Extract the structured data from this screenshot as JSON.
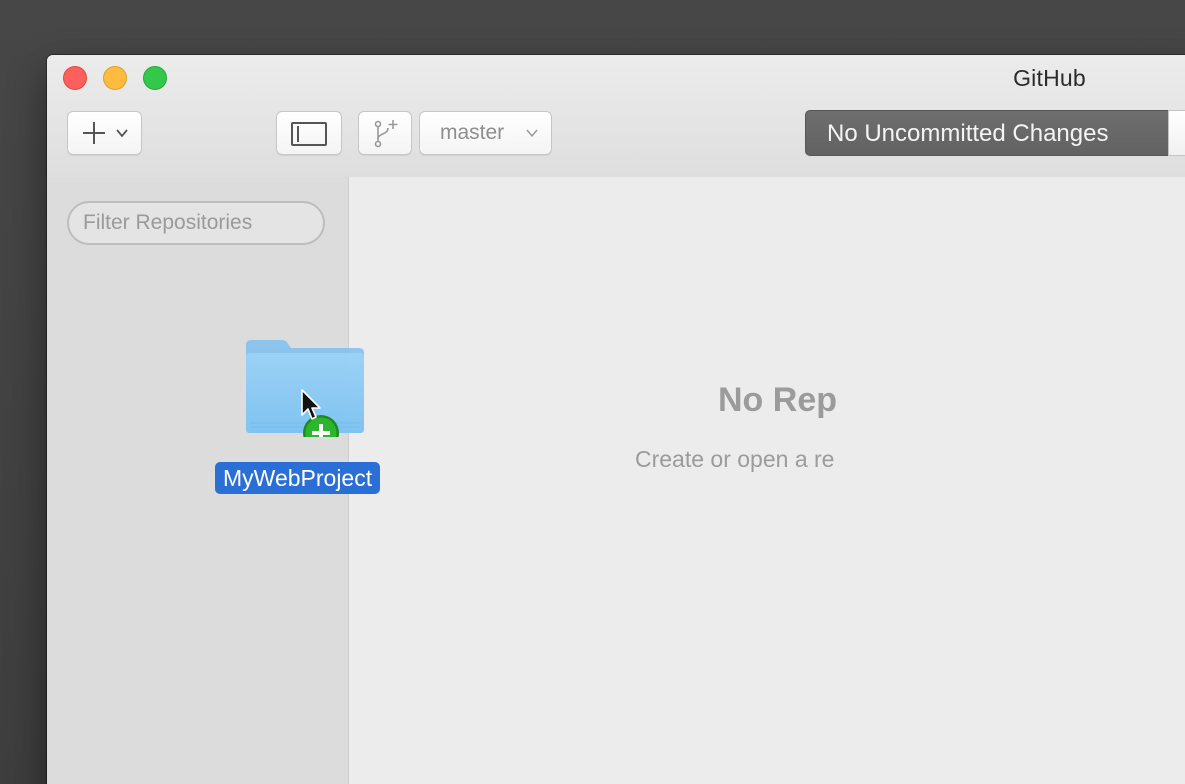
{
  "window": {
    "title": "GitHub"
  },
  "toolbar": {
    "add_icon": "plus-icon",
    "add_chevron_icon": "chevron-down-icon",
    "sidebar_toggle_icon": "sidebar-icon",
    "branch_icon": "new-branch-icon",
    "branch_name": "master",
    "status_label": "No Uncommitted Changes"
  },
  "sidebar": {
    "filter_placeholder": "Filter Repositories"
  },
  "main": {
    "empty_title": "No Rep",
    "empty_subtitle": "Create or open a re"
  },
  "drag": {
    "folder_icon": "folder-icon",
    "badge_icon": "add-badge-icon",
    "folder_name": "MyWebProject"
  },
  "colors": {
    "close": "#fc605c",
    "minimize": "#fdbc40",
    "zoom": "#34c84a",
    "selection": "#2a6fd6",
    "status_segment": "#666666"
  }
}
